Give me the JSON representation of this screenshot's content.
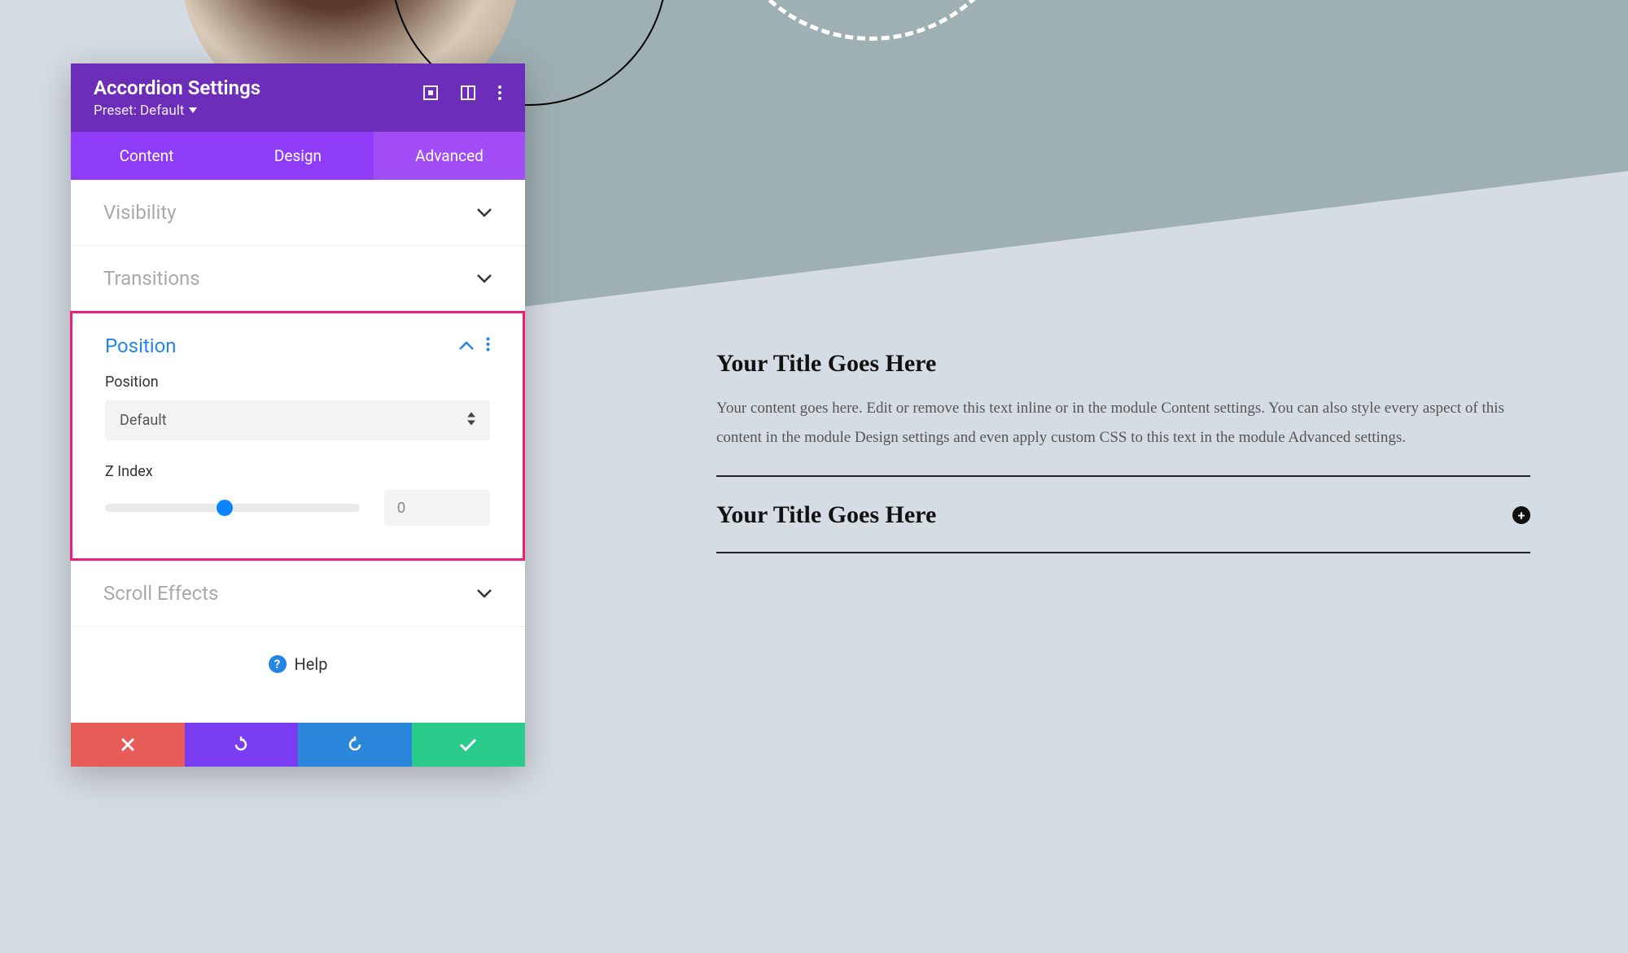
{
  "panel": {
    "title": "Accordion Settings",
    "preset": "Preset: Default",
    "tabs": {
      "content": "Content",
      "design": "Design",
      "advanced": "Advanced",
      "active": "advanced"
    },
    "sections": {
      "visibility": "Visibility",
      "transitions": "Transitions",
      "position": "Position",
      "scroll_effects": "Scroll Effects"
    },
    "position_section": {
      "position_label": "Position",
      "position_value": "Default",
      "zindex_label": "Z Index",
      "zindex_value": "0",
      "slider_percent": 47
    },
    "help": "Help"
  },
  "preview": {
    "items": [
      {
        "title": "Your Title Goes Here",
        "body": "Your content goes here. Edit or remove this text inline or in the module Content settings. You can also style every aspect of this content in the module Design settings and even apply custom CSS to this text in the module Advanced settings.",
        "open": true
      },
      {
        "title": "Your Title Goes Here",
        "body": "",
        "open": false
      }
    ]
  },
  "colors": {
    "highlight": "#ec1e79",
    "header": "#6c2eb9",
    "tabsbar": "#8e3cf7",
    "tab_active": "#a24cf5",
    "link": "#2585e6"
  }
}
